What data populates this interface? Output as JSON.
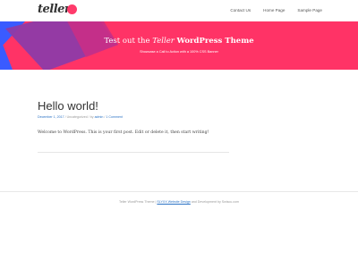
{
  "header": {
    "logo_text": "teller",
    "nav": [
      "Contact Us",
      "Home Page",
      "Sample Page"
    ]
  },
  "hero": {
    "title_prefix": "Test out the",
    "title_brand": "Teller",
    "title_suffix": "WordPress Theme",
    "subtitle": "Showcase a Call to Action with a 100% CSS Banner",
    "colors": {
      "base": "#ff3366",
      "purple": "#8e3ba8",
      "blue": "#3a5bff"
    }
  },
  "post": {
    "title": "Hello world!",
    "date": "December 1, 2017",
    "category": "Uncategorized",
    "by": "by",
    "author": "admin",
    "comments": "1 Comment",
    "body": "Welcome to WordPress. This is your first post. Edit or delete it, then start writing!"
  },
  "footer": {
    "prefix": "Teller WordPress Theme",
    "design_link": "SLYXX Website Design",
    "suffix": "and Development by Swiscu.com"
  }
}
